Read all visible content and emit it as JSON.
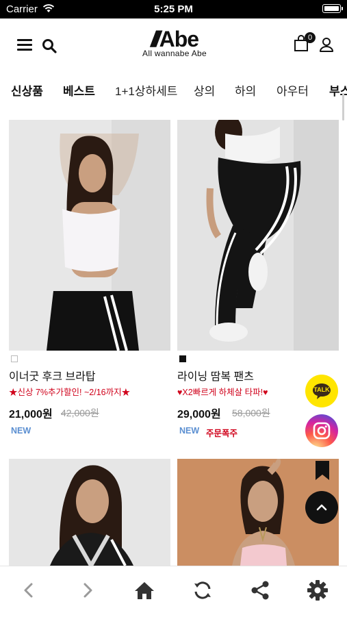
{
  "status_bar": {
    "carrier": "Carrier",
    "time": "5:25 PM"
  },
  "header": {
    "logo_mark": "Abe",
    "logo_tagline": "All wannabe Abe",
    "cart_count": "0"
  },
  "tabs": [
    "신상품",
    "베스트",
    "1+1상하세트",
    "상의",
    "하의",
    "아우터",
    "부스"
  ],
  "products": [
    {
      "name": "이너굿 후크 브라탑",
      "promo": "★신상 7%추가할인! ~2/16까지★",
      "price": "21,000원",
      "original_price": "42,000원",
      "badges": [
        "NEW"
      ],
      "swatch_color": "#ffffff"
    },
    {
      "name": "라이닝 땀복 팬츠",
      "promo": "♥X2빠르게 하체살 타파!♥",
      "price": "29,000원",
      "original_price": "58,000원",
      "badges": [
        "NEW",
        "주문폭주"
      ],
      "swatch_color": "#111111"
    },
    {
      "name": "",
      "promo": "",
      "price": "",
      "original_price": "",
      "badges": []
    },
    {
      "name": "",
      "promo": "",
      "price": "",
      "original_price": "",
      "badges": []
    }
  ],
  "floating": {
    "talk_label": "TALK"
  },
  "bottom_bar": [
    "back-icon",
    "forward-icon",
    "home-icon",
    "refresh-icon",
    "share-icon",
    "settings-icon"
  ],
  "colors": {
    "promo_red": "#d0021b",
    "new_blue": "#5b8fd1",
    "kakao_yellow": "#ffe500"
  }
}
